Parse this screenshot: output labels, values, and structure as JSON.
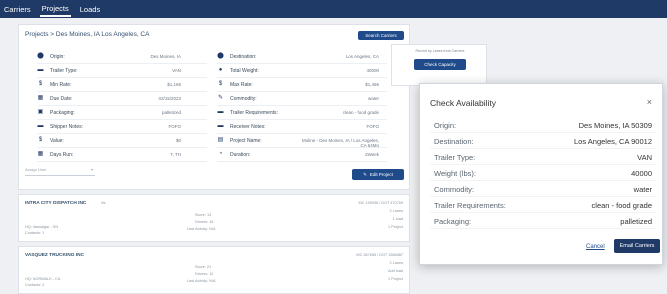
{
  "nav": {
    "items": [
      "Carriers",
      "Projects",
      "Loads"
    ]
  },
  "breadcrumb": "Projects > Des Moines, IA Los Angeles, CA",
  "search_button": "Search Carriers",
  "left_fields": [
    {
      "label": "Origin:",
      "value": "Des Moines, IA",
      "icon": "pin-icon"
    },
    {
      "label": "Trailer Type:",
      "value": "VAN",
      "icon": "truck-icon"
    },
    {
      "label": "Min Rate:",
      "value": "$1,166",
      "icon": "dollar-icon"
    },
    {
      "label": "Due Date:",
      "value": "02/15/2022",
      "icon": "calendar-icon"
    },
    {
      "label": "Packaging:",
      "value": "palletized",
      "icon": "box-icon"
    },
    {
      "label": "Shipper Notes:",
      "value": "FOFO",
      "icon": "truck-icon"
    },
    {
      "label": "Value:",
      "value": "$0",
      "icon": "dollar-icon"
    },
    {
      "label": "Days Run:",
      "value": "T, TH",
      "icon": "calendar-icon"
    }
  ],
  "right_fields": [
    {
      "label": "Destination:",
      "value": "Los Angeles, CA",
      "icon": "pin-icon"
    },
    {
      "label": "Total Weight:",
      "value": "40000",
      "icon": "weight-icon"
    },
    {
      "label": "Max Rate:",
      "value": "$1,466",
      "icon": "dollar-icon"
    },
    {
      "label": "Commodity:",
      "value": "water",
      "icon": "pen-icon"
    },
    {
      "label": "Trailer Requirements:",
      "value": "clean - food grade",
      "icon": "truck-icon"
    },
    {
      "label": "Receiver Notes:",
      "value": "FOFO",
      "icon": "truck-icon"
    },
    {
      "label": "Project Name:",
      "value": "Moline - Des Moines, IA / Los Angeles, CA 64Mo",
      "icon": "doc-icon"
    },
    {
      "label": "Duration:",
      "value": "2Week",
      "icon": "clock-icon"
    }
  ],
  "dropdown": "Assign User",
  "edit_button": "Edit Project",
  "side": {
    "note": "Recruit by Lanes from Carriers",
    "button": "Check Capacity"
  },
  "carriers": [
    {
      "name": "INTRA CITY DISPATCH INC",
      "location": "HQ: Vassalgar - SN",
      "contacts": "Contacts: 1",
      "score": "Score: 13",
      "drivers": "Drivers: 18",
      "activity": "Last Activity: N/A",
      "mc": "MC 199936 / DOT 470769",
      "lanes": "2 Lanes",
      "loads": "1 load",
      "projects": "1 Project"
    },
    {
      "name": "VASQUEZ TRUCKING INC",
      "location": "HQ: NORWALK - CA",
      "contacts": "Contacts: 2",
      "score": "Score: 21",
      "drivers": "Drivers: 12",
      "activity": "Last Activity: N/A",
      "mc": "MC 367655 / DOT 1565887",
      "lanes": "2 Lanes",
      "loads": "Add load",
      "projects": "1 Project"
    }
  ],
  "modal": {
    "title": "Check Availability",
    "close": "×",
    "rows": [
      {
        "label": "Origin:",
        "value": "Des Moines, IA 50309"
      },
      {
        "label": "Destination:",
        "value": "Los Angeles, CA 90012"
      },
      {
        "label": "Trailer Type:",
        "value": "VAN"
      },
      {
        "label": "Weight (lbs):",
        "value": "40000"
      },
      {
        "label": "Commodity:",
        "value": "water"
      },
      {
        "label": "Trailer Requirements:",
        "value": "clean - food grade"
      },
      {
        "label": "Packaging:",
        "value": "palletized"
      }
    ],
    "cancel": "Cancel",
    "email": "Email Carriers"
  },
  "colors": {
    "nav_bg": "#1f3a66",
    "primary": "#1f4b8a"
  }
}
